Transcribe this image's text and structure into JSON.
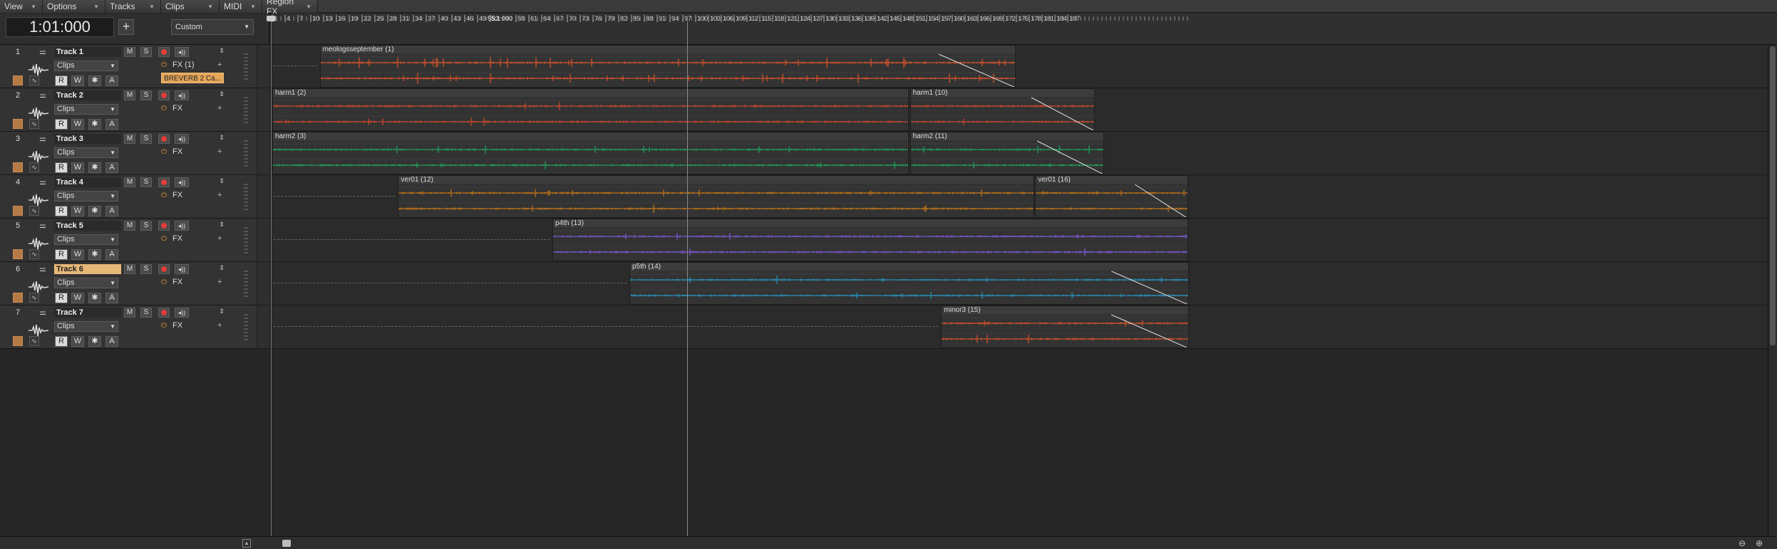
{
  "menu": [
    {
      "label": "View"
    },
    {
      "label": "Options"
    },
    {
      "label": "Tracks"
    },
    {
      "label": "Clips"
    },
    {
      "label": "MIDI"
    },
    {
      "label": "Region FX"
    }
  ],
  "transport": {
    "time": "1:01:000",
    "add_symbol": "+",
    "preset": "Custom"
  },
  "ruler": {
    "playhead_label": "55:1:000",
    "bars": [
      1,
      4,
      7,
      10,
      13,
      16,
      19,
      22,
      25,
      28,
      31,
      34,
      37,
      40,
      43,
      46,
      49,
      52,
      58,
      61,
      64,
      67,
      70,
      73,
      76,
      79,
      82,
      85,
      88,
      91,
      94,
      97,
      100,
      103,
      106,
      109,
      112,
      115,
      118,
      121,
      124,
      127,
      130,
      133,
      136,
      139,
      142,
      145,
      148,
      151,
      154,
      157,
      160,
      163,
      166,
      169,
      172,
      175,
      178,
      181,
      184,
      187
    ]
  },
  "tracks": [
    {
      "num": "1",
      "name": "Track 1",
      "mode": "Clips",
      "fx": "FX (1)",
      "plugin": "BREVERB 2 Ca...",
      "selected": false
    },
    {
      "num": "2",
      "name": "Track 2",
      "mode": "Clips",
      "fx": "FX",
      "plugin": "",
      "selected": false
    },
    {
      "num": "3",
      "name": "Track 3",
      "mode": "Clips",
      "fx": "FX",
      "plugin": "",
      "selected": false
    },
    {
      "num": "4",
      "name": "Track 4",
      "mode": "Clips",
      "fx": "FX",
      "plugin": "",
      "selected": false
    },
    {
      "num": "5",
      "name": "Track 5",
      "mode": "Clips",
      "fx": "FX",
      "plugin": "",
      "selected": false
    },
    {
      "num": "6",
      "name": "Track 6",
      "mode": "Clips",
      "fx": "FX",
      "plugin": "",
      "selected": true
    },
    {
      "num": "7",
      "name": "Track 7",
      "mode": "Clips",
      "fx": "FX",
      "plugin": "",
      "selected": false
    }
  ],
  "buttons": {
    "m": "M",
    "s": "S",
    "r": "R",
    "w": "W",
    "star": "✱",
    "a": "A"
  },
  "clips": [
    {
      "track": 0,
      "title": "meologsseptember (1)",
      "start_bar": 12.1,
      "end_bar": 174.9,
      "color": "#d4532c",
      "fade_out": true,
      "dense": true
    },
    {
      "track": 1,
      "title": "harm1 (2)",
      "start_bar": 1,
      "end_bar": 149.8,
      "color": "#c9492e",
      "fade_out": false
    },
    {
      "track": 1,
      "title": "harm1 (10)",
      "start_bar": 150.1,
      "end_bar": 193.4,
      "color": "#c9492e",
      "fade_out": true
    },
    {
      "track": 2,
      "title": "harm2 (3)",
      "start_bar": 1,
      "end_bar": 149.8,
      "color": "#21a05a",
      "fade_out": false
    },
    {
      "track": 2,
      "title": "harm2 (11)",
      "start_bar": 150.1,
      "end_bar": 195.5,
      "color": "#21a05a",
      "fade_out": true
    },
    {
      "track": 3,
      "title": "ver01 (12)",
      "start_bar": 30.4,
      "end_bar": 179.1,
      "color": "#c07518",
      "fade_out": false
    },
    {
      "track": 3,
      "title": "ver01 (16)",
      "start_bar": 179.4,
      "end_bar": 215.1,
      "color": "#c07518",
      "fade_out": true
    },
    {
      "track": 4,
      "title": "p4th (13)",
      "start_bar": 66.5,
      "end_bar": 215.1,
      "color": "#7a58d0",
      "fade_out": false
    },
    {
      "track": 5,
      "title": "p5th (14)",
      "start_bar": 84.5,
      "end_bar": 215.4,
      "color": "#2a91b8",
      "fade_out": true
    },
    {
      "track": 6,
      "title": "minor3 (15)",
      "start_bar": 157.4,
      "end_bar": 215.4,
      "color": "#d2512c",
      "fade_out": true
    }
  ],
  "colors": {
    "accent_orange": "#e6a75a",
    "rec_red": "#e23b3b",
    "selected_name": "#e6b877"
  },
  "icons": {
    "sliders": "⚌",
    "power": "⏻",
    "speaker": "◂))",
    "collapse": "⇕",
    "zoom_out": "🔍",
    "zoom_in": "🔍"
  }
}
